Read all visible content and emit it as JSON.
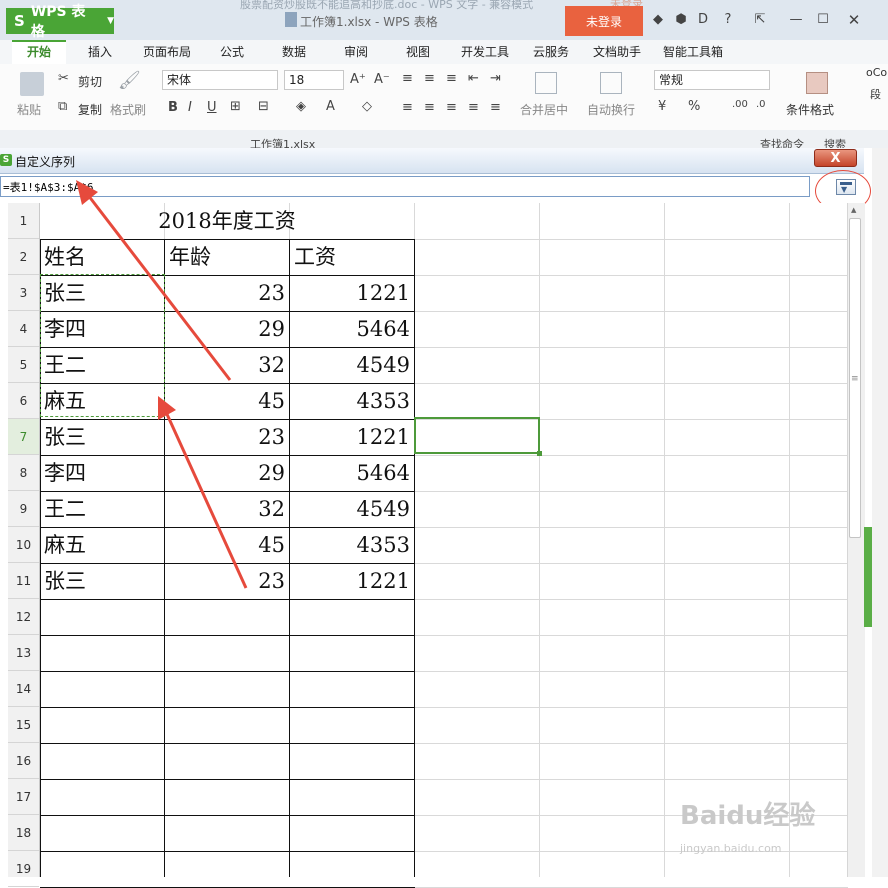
{
  "window": {
    "app_name": "WPS 表格",
    "doc_title": "工作簿1.xlsx - WPS 表格",
    "faded_tab": "股票配资炒股既不能追高和抄底.doc - WPS 文字 - 兼容模式",
    "login_label": "未登录",
    "login_faded": "未登录"
  },
  "menu": {
    "tabs": [
      "开始",
      "插入",
      "页面布局",
      "公式",
      "数据",
      "审阅",
      "视图",
      "开发工具",
      "云服务",
      "文档助手",
      "智能工具箱"
    ]
  },
  "ribbon": {
    "paste": "粘贴",
    "cut": "剪切",
    "copy": "复制",
    "format_painter": "格式刷",
    "font_name": "宋体",
    "font_size": "18",
    "merge_center": "合并居中",
    "auto_wrap": "自动换行",
    "number_format": "常规",
    "cond_format": "条件格式",
    "right_clip1": "oCo",
    "right_clip2": "段"
  },
  "quickbar": {
    "file_tab": "工作簿1.xlsx",
    "search_cmd": "查找命令",
    "search": "搜索"
  },
  "dialog": {
    "title": "自定义序列",
    "close_label": "X",
    "ref_value": "=表1!$A$3:$A$6"
  },
  "sheet": {
    "row_numbers": [
      "1",
      "2",
      "3",
      "4",
      "5",
      "6",
      "7",
      "8",
      "9",
      "10",
      "11",
      "12",
      "13",
      "14",
      "15",
      "16",
      "17",
      "18",
      "19"
    ],
    "active_row": "7",
    "title": "2018年度工资",
    "headers": [
      "姓名",
      "年龄",
      "工资"
    ],
    "rows": [
      {
        "name": "张三",
        "age": "23",
        "salary": "1221"
      },
      {
        "name": "李四",
        "age": "29",
        "salary": "5464"
      },
      {
        "name": "王二",
        "age": "32",
        "salary": "4549"
      },
      {
        "name": "麻五",
        "age": "45",
        "salary": "4353"
      },
      {
        "name": "张三",
        "age": "23",
        "salary": "1221"
      },
      {
        "name": "李四",
        "age": "29",
        "salary": "5464"
      },
      {
        "name": "王二",
        "age": "32",
        "salary": "4549"
      },
      {
        "name": "麻五",
        "age": "45",
        "salary": "4353"
      },
      {
        "name": "张三",
        "age": "23",
        "salary": "1221"
      }
    ]
  },
  "colors": {
    "wps_green": "#4aa536",
    "login_orange": "#e9623f",
    "annotation_red": "#e64a3c",
    "selection_green": "#5aae46"
  },
  "watermark": {
    "main": "Baidu经验",
    "sub": "jingyan.baidu.com"
  }
}
